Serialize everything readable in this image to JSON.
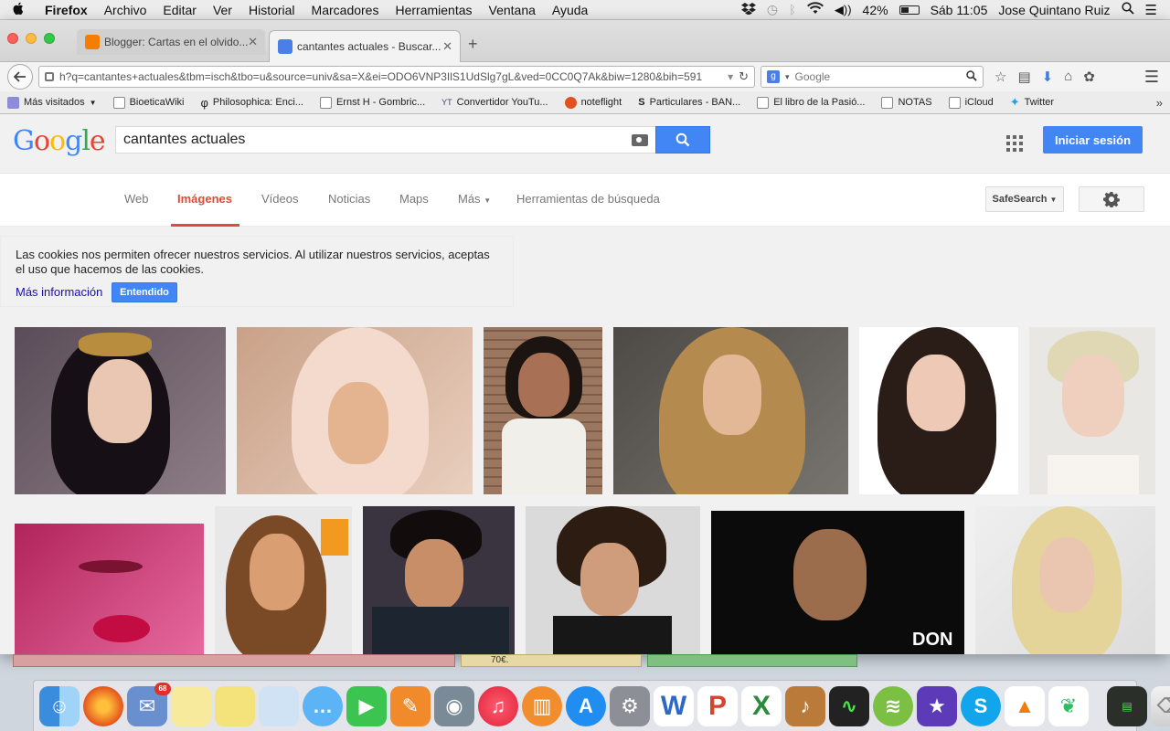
{
  "menubar": {
    "apple": "",
    "items": [
      "Firefox",
      "Archivo",
      "Editar",
      "Ver",
      "Historial",
      "Marcadores",
      "Herramientas",
      "Ventana",
      "Ayuda"
    ],
    "battery": "42%",
    "clock": "Sáb 11:05",
    "user": "Jose Quintano Ruiz"
  },
  "browser": {
    "tabs": [
      {
        "label": "Blogger: Cartas en el olvido...",
        "active": false
      },
      {
        "label": "cantantes actuales - Buscar...",
        "active": true
      }
    ],
    "newtab": "+",
    "url": "h?q=cantantes+actuales&tbm=isch&tbo=u&source=univ&sa=X&ei=ODO6VNP3IlS1UdSlg7gL&ved=0CC0Q7Ak&biw=1280&bih=591",
    "search_placeholder": "Google",
    "bookmarks": [
      "Más visitados",
      "BioeticaWiki",
      "Philosophica: Enci...",
      "Ernst H - Gombric...",
      "Convertidor YouTu...",
      "noteflight",
      "Particulares - BAN...",
      "El libro de la Pasió...",
      "NOTAS",
      "iCloud",
      "Twitter"
    ]
  },
  "google": {
    "logo": "Google",
    "query": "cantantes actuales",
    "signin": "Iniciar sesión",
    "tabs": [
      "Web",
      "Imágenes",
      "Vídeos",
      "Noticias",
      "Maps",
      "Más",
      "Herramientas de búsqueda"
    ],
    "safesearch": "SafeSearch",
    "cookie_text": "Las cookies nos permiten ofrecer nuestros servicios. Al utilizar nuestros servicios, aceptas el uso que hacemos de las cookies.",
    "cookie_more": "Más información",
    "cookie_ok": "Entendido"
  },
  "desktop": {
    "note_price": "70€.",
    "dock_badge": "68"
  },
  "colors": {
    "google_blue": "#4285f4",
    "google_red": "#dd4b39",
    "link": "#1a0dab"
  }
}
